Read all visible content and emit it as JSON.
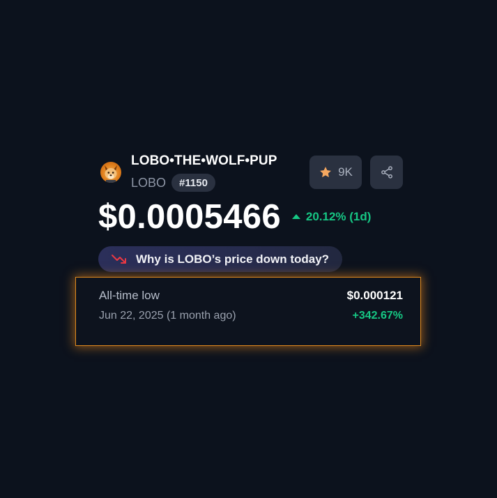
{
  "coin": {
    "name": "LOBO•THE•WOLF•PUP",
    "symbol": "LOBO",
    "rank": "#1150",
    "logo_icon": "wolf-pup-logo"
  },
  "actions": {
    "watchlist_count": "9K",
    "watchlist_icon": "star-icon",
    "share_icon": "share-icon"
  },
  "price": {
    "value": "$0.0005466",
    "change": "20.12% (1d)",
    "direction": "up"
  },
  "why_prompt": {
    "text": "Why is LOBO’s price down today?",
    "icon": "trend-down-icon"
  },
  "all_time_low": {
    "label": "All-time low",
    "value": "$0.000121",
    "date": "Jun 22, 2025 (1 month ago)",
    "change": "+342.67%"
  },
  "colors": {
    "background": "#0c121d",
    "positive": "#16c784",
    "negative": "#ea3943",
    "highlight_border": "#e08a1e",
    "button_bg": "#2a3140",
    "star": "#f5a860"
  }
}
